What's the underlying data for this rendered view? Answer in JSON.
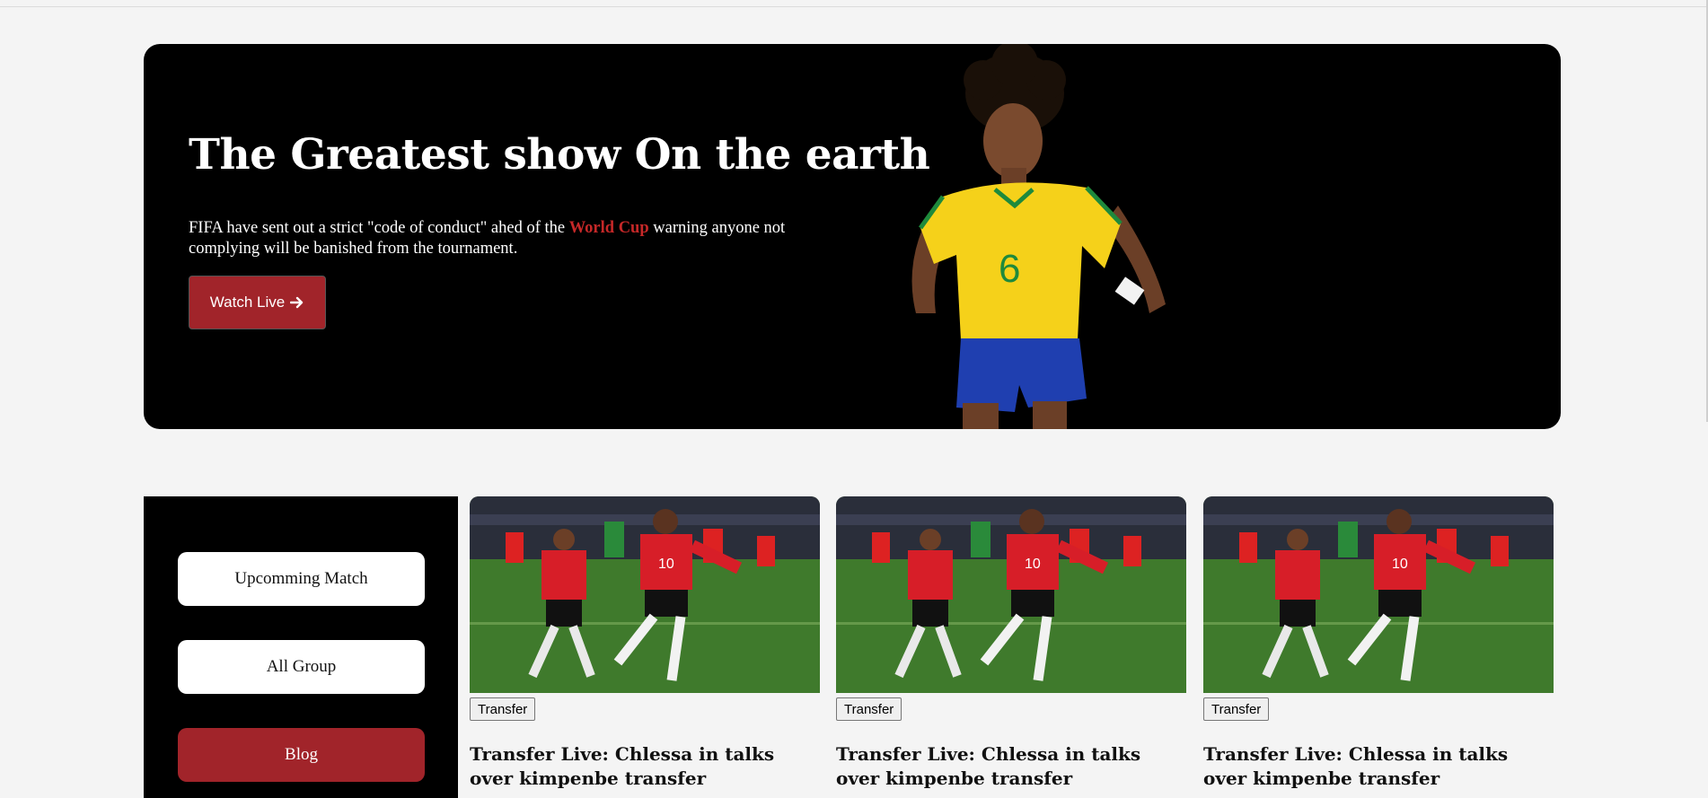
{
  "hero": {
    "title": "The Greatest show On the earth",
    "text_before": "FIFA have sent out a strict \"code of conduct\" ahed of the ",
    "highlight": "World Cup",
    "text_after": " warning anyone not complying will be banished from the tournament.",
    "button_label": "Watch Live",
    "button_icon": "arrow-right-icon",
    "player_number": "6"
  },
  "sidebar": {
    "items": [
      {
        "label": "Upcomming Match",
        "active": false
      },
      {
        "label": "All Group",
        "active": false
      },
      {
        "label": "Blog",
        "active": true
      }
    ]
  },
  "cards": [
    {
      "tag": "Transfer",
      "title": "Transfer Live: Chlessa in talks over kimpenbe transfer",
      "jersey_number": "10"
    },
    {
      "tag": "Transfer",
      "title": "Transfer Live: Chlessa in talks over kimpenbe transfer",
      "jersey_number": "10"
    },
    {
      "tag": "Transfer",
      "title": "Transfer Live: Chlessa in talks over kimpenbe transfer",
      "jersey_number": "10"
    }
  ],
  "colors": {
    "accent": "#a1242a",
    "highlight": "#c62828",
    "page_bg": "#f4f4f4",
    "hero_bg": "#000000"
  }
}
